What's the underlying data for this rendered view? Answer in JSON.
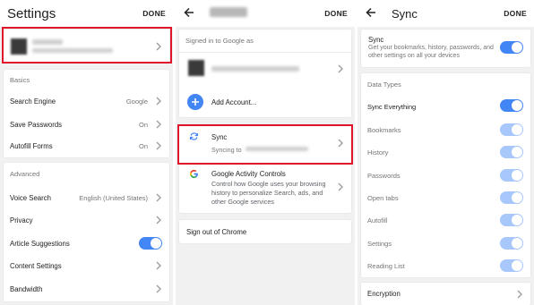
{
  "settings": {
    "title": "Settings",
    "done": "DONE",
    "basics_header": "Basics",
    "basics": [
      {
        "label": "Search Engine",
        "value": "Google"
      },
      {
        "label": "Save Passwords",
        "value": "On"
      },
      {
        "label": "Autofill Forms",
        "value": "On"
      }
    ],
    "advanced_header": "Advanced",
    "advanced": [
      {
        "label": "Voice Search",
        "value": "English (United States)"
      },
      {
        "label": "Privacy",
        "value": ""
      },
      {
        "label": "Article Suggestions",
        "value": ""
      },
      {
        "label": "Content Settings",
        "value": ""
      },
      {
        "label": "Bandwidth",
        "value": ""
      }
    ]
  },
  "account": {
    "done": "DONE",
    "signed_in_header": "Signed in to Google as",
    "add_account": "Add Account...",
    "sync_title": "Sync",
    "sync_sub": "Syncing to",
    "activity_title": "Google Activity Controls",
    "activity_desc": "Control how Google uses your browsing history to personalize Search, ads, and other Google services",
    "sign_out": "Sign out of Chrome"
  },
  "sync": {
    "title": "Sync",
    "done": "DONE",
    "sync_label": "Sync",
    "sync_desc": "Get your bookmarks, history, passwords, and other settings on all your devices",
    "data_types_header": "Data Types",
    "sync_everything": "Sync Everything",
    "types": [
      "Bookmarks",
      "History",
      "Passwords",
      "Open tabs",
      "Autofill",
      "Settings",
      "Reading List"
    ],
    "encryption": "Encryption"
  },
  "colors": {
    "accent": "#4285f4",
    "toggle_dim": "#a8c7fa",
    "highlight": "#e0142a"
  },
  "icons": [
    "back-arrow-icon",
    "chevron-right-icon",
    "sync-icon",
    "google-g-icon",
    "plus-icon"
  ]
}
